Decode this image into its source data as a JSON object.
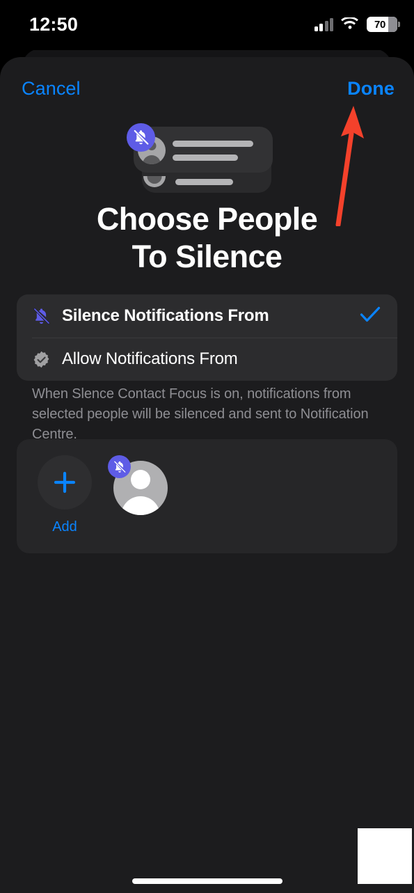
{
  "status_bar": {
    "time": "12:50",
    "battery_percent": "70",
    "icons": [
      "cellular-signal-icon",
      "wifi-icon",
      "battery-icon"
    ]
  },
  "nav": {
    "cancel_label": "Cancel",
    "done_label": "Done"
  },
  "hero": {
    "badge_icon": "bell-slash-icon",
    "description": "notification-card-illustration"
  },
  "title": {
    "line1": "Choose People",
    "line2": "To Silence"
  },
  "options": [
    {
      "label": "Silence Notifications From",
      "icon": "bell-slash-icon",
      "selected": true,
      "check_icon": "checkmark-icon"
    },
    {
      "label": "Allow Notifications From",
      "icon": "checkmark-seal-icon",
      "selected": false
    }
  ],
  "footnote": "When Slence Contact Focus is on, notifications from selected people will be silenced and sent to Notification Centre.",
  "people": {
    "add_label": "Add",
    "add_icon": "plus-icon",
    "entries": [
      {
        "avatar_icon": "person-fill-icon",
        "badge_icon": "bell-slash-icon"
      }
    ]
  },
  "annotation": {
    "type": "arrow",
    "points_to": "done-button",
    "color": "#F4412B"
  },
  "colors": {
    "accent_blue": "#0A84FF",
    "badge_purple": "#5E5CE6",
    "sheet_bg": "#1C1C1E",
    "card_bg": "#2C2C2E",
    "secondary_text": "#8E8E93"
  },
  "home_indicator": "home-indicator-bar"
}
